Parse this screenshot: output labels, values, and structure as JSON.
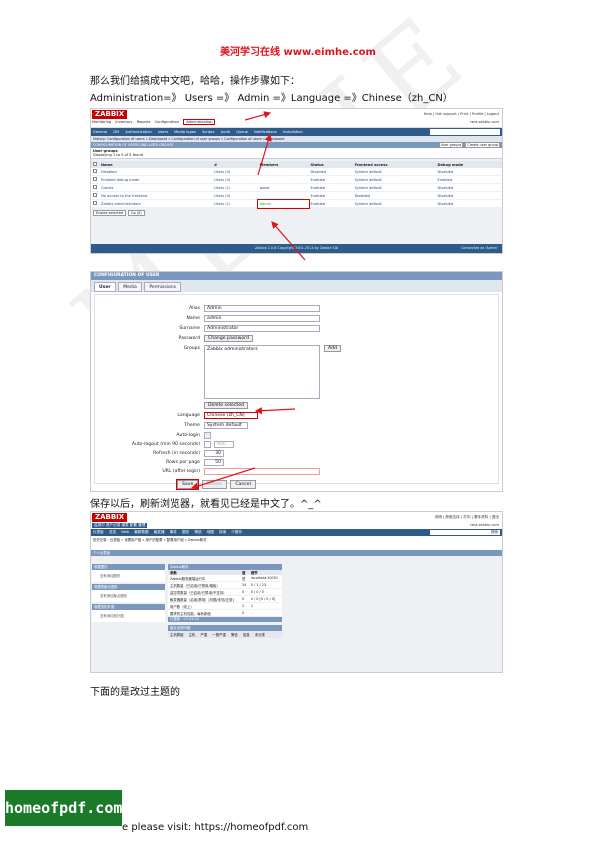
{
  "header": {
    "title": "美河学习在线 www.eimhe.com"
  },
  "paragraphs": {
    "intro": "那么我们给搞成中文吧，哈哈，操作步骤如下：",
    "path": "Administration=》 Users =》 Admin =》Language =》Chinese（zh_CN）",
    "after_save": "保存以后，刷新浏览器，就看见已经是中文了。^_^",
    "theme_note": "下面的是改过主题的"
  },
  "watermark": "MEIHE",
  "shot1": {
    "logo": "ZABBIX",
    "menu": [
      "Monitoring",
      "Inventory",
      "Reports",
      "Configuration"
    ],
    "menu_admin": "Administration",
    "top_links": "Help | Get support | Print | Profile | Logout",
    "host": "test.zabbix.com",
    "submenu": [
      "General",
      "DM",
      "Authentication",
      "Users",
      "Media types",
      "Scripts",
      "Audit",
      "Queue",
      "Notifications",
      "Installation"
    ],
    "search_label": "Search",
    "history": "History: Configuration of users » Dashboard » Configuration of user groups » Configuration of users » Dashboard",
    "bar_title": "CONFIGURATION OF USERS AND USER GROUPS",
    "bar_select": "User groups",
    "bar_create": "Create user group",
    "section_title": "User groups",
    "displaying": "Displaying 1 to 5 of 5 found",
    "columns": [
      "Name",
      "#",
      "Members",
      "Status",
      "Frontend access",
      "Debug mode"
    ],
    "rows": [
      {
        "name": "Disabled",
        "count": "Users (0)",
        "members": "",
        "status": "Disabled",
        "frontend": "System default",
        "debug": "Disabled"
      },
      {
        "name": "Enabled debug mode",
        "count": "Users (0)",
        "members": "",
        "status": "Enabled",
        "frontend": "System default",
        "debug": "Enabled"
      },
      {
        "name": "Guests",
        "count": "Users (1)",
        "members": "guest",
        "status": "Enabled",
        "frontend": "System default",
        "debug": "Disabled"
      },
      {
        "name": "No access to the frontend",
        "count": "Users (0)",
        "members": "",
        "status": "Enabled",
        "frontend": "Disabled",
        "debug": "Disabled"
      },
      {
        "name": "Zabbix administrators",
        "count": "Users (1)",
        "members": "Admin",
        "status": "Enabled",
        "frontend": "System default",
        "debug": "Disabled"
      }
    ],
    "footer_select": "Enable selected",
    "footer_go": "Go (0)",
    "footer": "Zabbix 2.0.6 Copyright 2001-2013 by Zabbix SIA",
    "connected": "Connected as 'Admin'"
  },
  "shot2": {
    "title": "CONFIGURATION OF USER",
    "tabs": [
      "User",
      "Media",
      "Permissions"
    ],
    "fields": {
      "alias_label": "Alias",
      "alias": "Admin",
      "name_label": "Name",
      "name": "admin",
      "surname_label": "Surname",
      "surname": "Administrator",
      "password_label": "Password",
      "password_btn": "Change password",
      "groups_label": "Groups",
      "groups_value": "Zabbix administrators",
      "add_btn": "Add",
      "delete_btn": "Delete selected",
      "language_label": "Language",
      "language": "Chinese (zh_CN)",
      "theme_label": "Theme",
      "theme": "System default",
      "autologin_label": "Auto-login",
      "autologout_label": "Auto-logout (min 90 seconds)",
      "autologout": "900",
      "refresh_label": "Refresh (in seconds)",
      "refresh": "30",
      "rows_label": "Rows per page",
      "rows": "50",
      "url_label": "URL (after login)",
      "url": ""
    },
    "buttons": [
      "Save",
      "Delete",
      "Cancel"
    ]
  },
  "shot3": {
    "logo": "ZABBIX",
    "menu": "监测中 资产记录 报表 配置 管理",
    "links": "说明 | 获取支持 | 打印 | 基本资料 | 退出",
    "host": "test.zabbix.com",
    "submenu": [
      "仪表板",
      "总览",
      "Web",
      "最新数据",
      "触发器",
      "事件",
      "图形",
      "筛选",
      "地图",
      "探索",
      "IT服务"
    ],
    "search": "搜索",
    "crumb": "历史记录：仪表板 » 设置用户组 » 用户的配置 » 配置用户组 » Zabbix概况",
    "bar": "个人仪表板",
    "widgets": [
      {
        "title": "收藏图形",
        "body": "没有添加图形"
      },
      {
        "title": "收藏的聚合图形",
        "body": "没有添加聚合图形"
      },
      {
        "title": "收藏的拓扑图",
        "body": "没有添加拓扑图"
      }
    ],
    "stat_title": "Zabbix概况",
    "stat_columns": [
      "参数",
      "值",
      "细节"
    ],
    "stats": [
      {
        "param": "Zabbix服务器端运行中",
        "value": "是",
        "detail": "localhost:10051"
      },
      {
        "param": "主机数量（已启用/已禁用/模板）",
        "value": "24",
        "detail": "0 / 1 / 23"
      },
      {
        "param": "监控项数量（已启用/已禁用/不支持）",
        "value": "0",
        "detail": "0 / 0 / 0"
      },
      {
        "param": "触发器数量（启用/禁用）[问题/未知/正常]",
        "value": "0",
        "detail": "0 / 0 [0 / 0 / 0]"
      },
      {
        "param": "用户数（线上）",
        "value": "2",
        "detail": "1"
      },
      {
        "param": "要求的主机性能，每秒新值",
        "value": "0",
        "detail": "-"
      }
    ],
    "updated": "已更新：07:43:24",
    "issues_title": "最近出现问题",
    "issues_columns": [
      "主机群组",
      "主机",
      "严重",
      "一般严重",
      "警告",
      "信息",
      "未分类"
    ]
  },
  "banner": "homeofpdf.com",
  "foot_text": "e please visit: https://homeofpdf.com"
}
